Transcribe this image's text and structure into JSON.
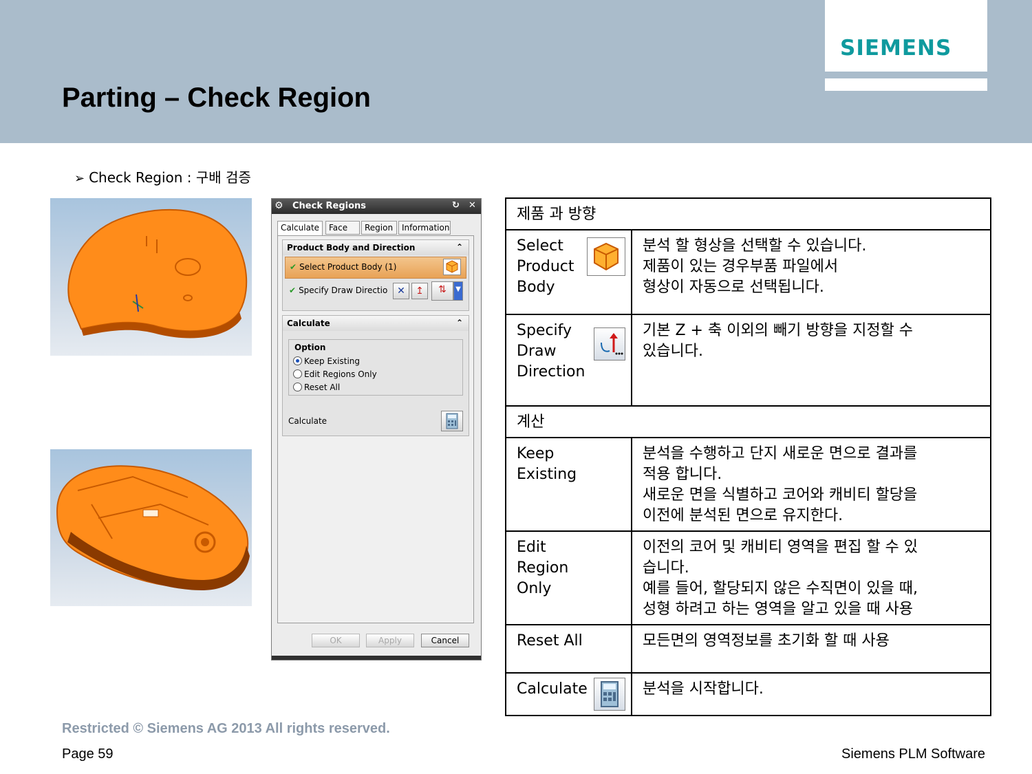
{
  "header": {
    "logo": "SIEMENS",
    "title": "Parting – Check Region"
  },
  "bullet": {
    "marker": "➢",
    "text": "Check Region :  구배 검증"
  },
  "dialog": {
    "title": "Check Regions",
    "tabs": [
      "Calculate",
      "Face",
      "Region",
      "Information"
    ],
    "group1": {
      "title": "Product Body and Direction",
      "select_body": "Select Product Body (1)",
      "specify_direction": "Specify Draw Directio"
    },
    "group2": {
      "title": "Calculate",
      "option_label": "Option",
      "options": [
        "Keep Existing",
        "Edit Regions Only",
        "Reset All"
      ],
      "selected_option": "Keep Existing",
      "calculate_label": "Calculate"
    },
    "buttons": {
      "ok": "OK",
      "apply": "Apply",
      "cancel": "Cancel"
    }
  },
  "table": {
    "section1": "제품 과 방향",
    "rows1": [
      {
        "name": [
          "Select",
          "Product",
          "Body"
        ],
        "icon": "cube-icon",
        "desc": [
          "분석 할 형상을 선택할 수 있습니다.",
          "제품이 있는 경우부품 파일에서",
          "형상이 자동으로 선택됩니다."
        ]
      },
      {
        "name": [
          "Specify",
          "Draw",
          "Direction"
        ],
        "icon": "draw-direction-icon",
        "desc": [
          "기본 Z + 축 이외의 빼기 방향을 지정할 수",
          "있습니다."
        ]
      }
    ],
    "section2": "계산",
    "rows2": [
      {
        "name": [
          "Keep",
          "Existing"
        ],
        "desc": [
          "분석을 수행하고 단지 새로운 면으로 결과를",
          "적용 합니다.",
          "새로운 면을 식별하고 코어와 캐비티 할당을",
          "이전에 분석된 면으로 유지한다."
        ]
      },
      {
        "name": [
          "Edit",
          "Region",
          "Only"
        ],
        "desc": [
          "이전의 코어 및 캐비티 영역을 편집 할 수 있",
          "습니다.",
          "예를 들어, 할당되지 않은 수직면이 있을 때,",
          "성형 하려고 하는 영역을 알고 있을 때 사용"
        ]
      },
      {
        "name": [
          "Reset All"
        ],
        "desc": [
          "모든면의 영역정보를 초기화 할 때 사용"
        ]
      },
      {
        "name": [
          "Calculate"
        ],
        "icon": "calculator-icon",
        "desc": [
          "분석을 시작합니다."
        ]
      }
    ]
  },
  "footer": {
    "restricted": "Restricted © Siemens AG 2013 All rights reserved.",
    "page": "Page 59",
    "company": "Siemens PLM Software"
  },
  "colors": {
    "header_bg": "#aabccb",
    "logo": "#0f9a9e",
    "part_orange": "#ff8c1a",
    "footer_grey": "#8c9aaa"
  }
}
